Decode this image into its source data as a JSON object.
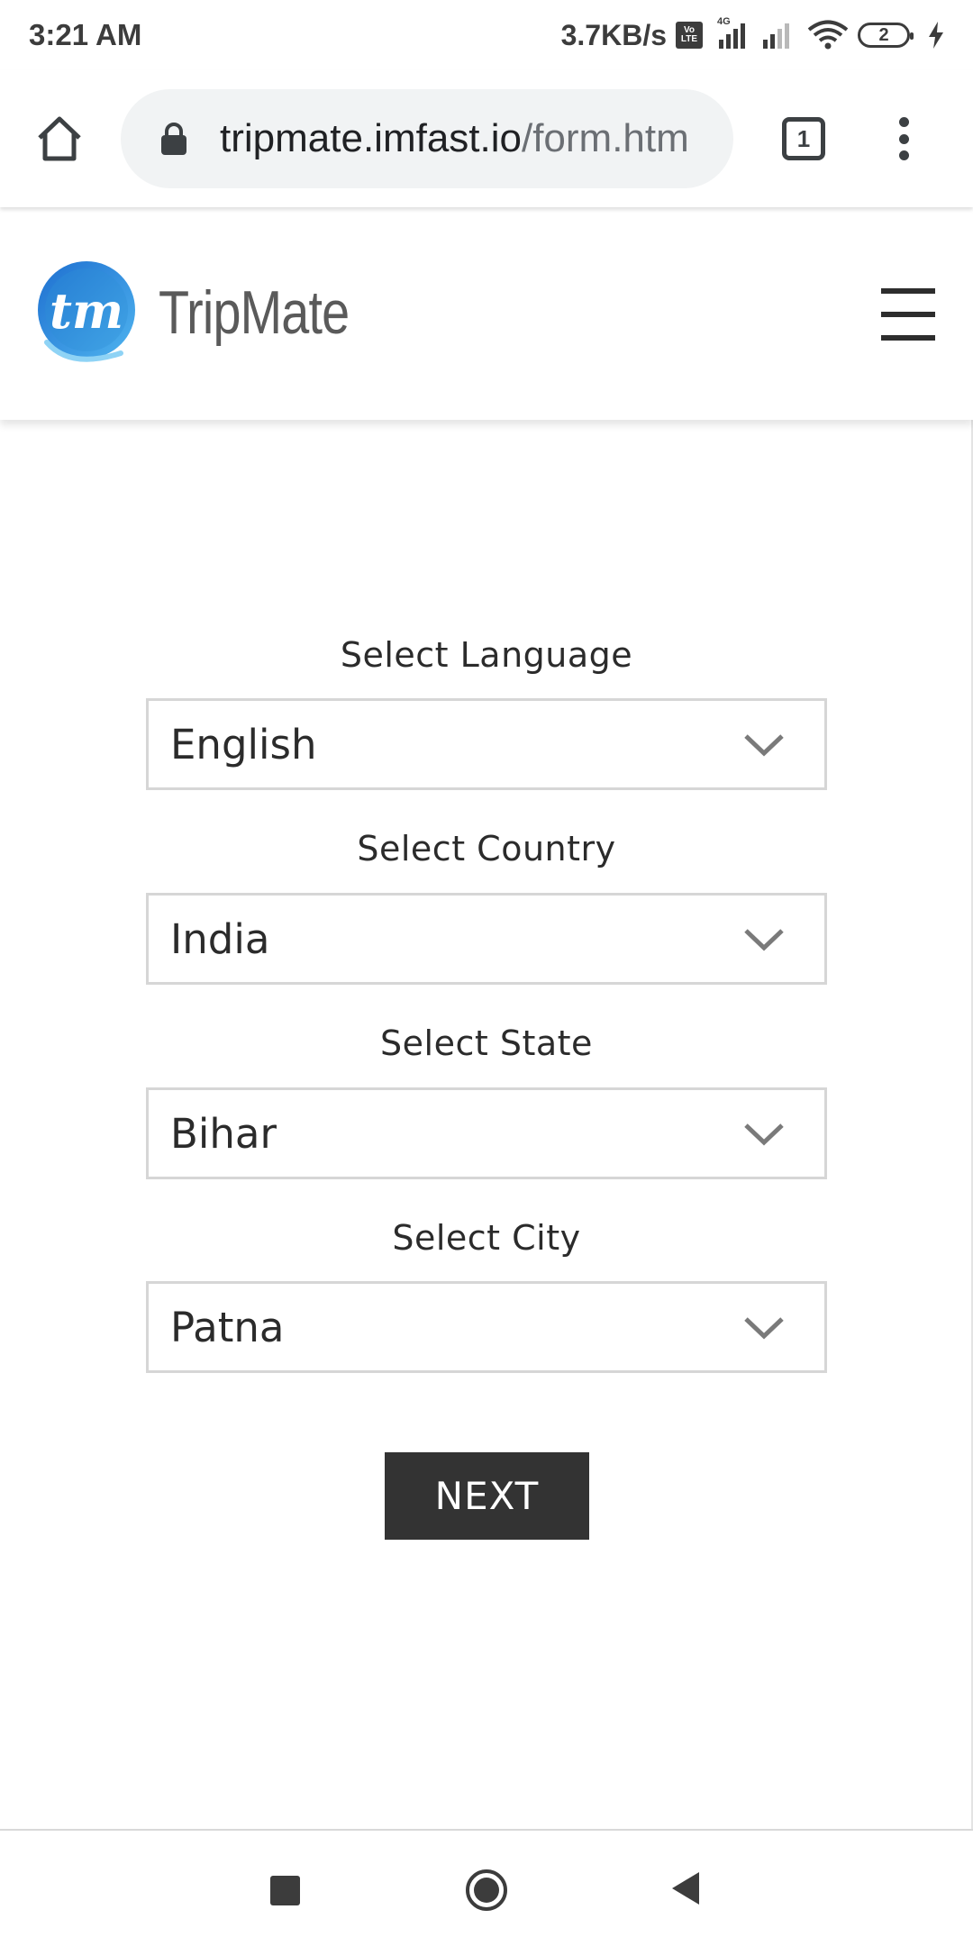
{
  "status_bar": {
    "time": "3:21 AM",
    "net_speed": "3.7KB/s",
    "volte_top": "Vo",
    "volte_bottom": "LTE",
    "network_type": "4G",
    "battery_level": "2"
  },
  "browser": {
    "url_host": "tripmate.imfast.io",
    "url_path": "/form.htm",
    "tab_count": "1",
    "icons": [
      "home-icon",
      "lock-icon",
      "tabs-icon",
      "more-vert-icon"
    ]
  },
  "site": {
    "logo_mark": "tm",
    "brand_name": "TripMate",
    "brand_color": "#2f8fd8",
    "menu_icon": "hamburger-icon"
  },
  "form": {
    "language": {
      "label": "Select Language",
      "value": "English"
    },
    "country": {
      "label": "Select Country",
      "value": "India"
    },
    "state": {
      "label": "Select State",
      "value": "Bihar"
    },
    "city": {
      "label": "Select City",
      "value": "Patna"
    },
    "next_label": "NEXT",
    "next_color": "#333333"
  },
  "nav": {
    "icons": [
      "recents-icon",
      "home-circle-icon",
      "back-icon"
    ]
  }
}
